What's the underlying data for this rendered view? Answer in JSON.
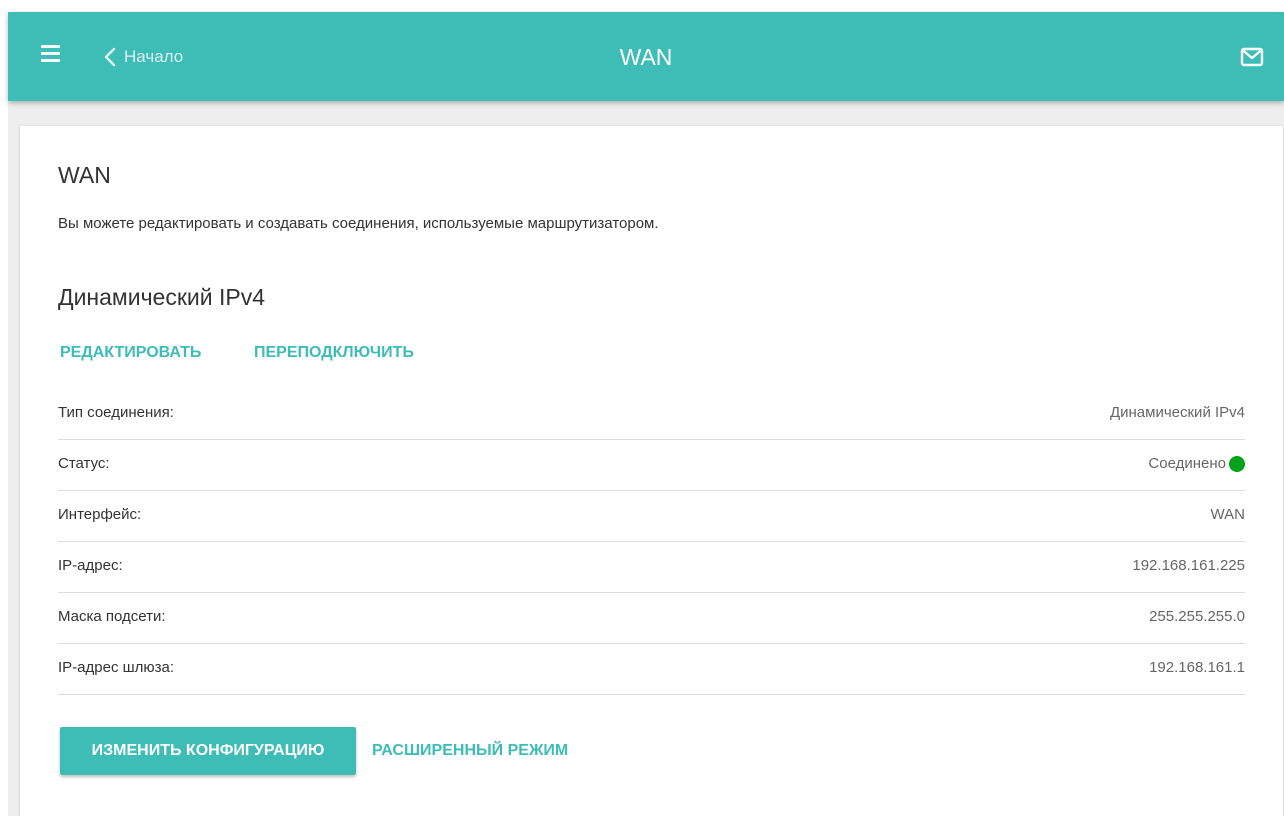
{
  "header": {
    "back_label": "Начало",
    "title": "WAN",
    "menu_icon": "hamburger-menu-icon",
    "back_icon": "chevron-left-icon",
    "mail_icon": "envelope-icon"
  },
  "card": {
    "title": "WAN",
    "description": "Вы можете редактировать и создавать соединения, используемые маршрутизатором."
  },
  "connection": {
    "name": "Динамический IPv4",
    "edit_label": "РЕДАКТИРОВАТЬ",
    "reconnect_label": "ПЕРЕПОДКЛЮЧИТЬ",
    "rows": [
      {
        "label": "Тип соединения:",
        "value": "Динамический IPv4"
      },
      {
        "label": "Статус:",
        "value": "Соединено",
        "status_color": "#00a31a"
      },
      {
        "label": "Интерфейс:",
        "value": "WAN"
      },
      {
        "label": "IP-адрес:",
        "value": "192.168.161.225"
      },
      {
        "label": "Маска подсети:",
        "value": "255.255.255.0"
      },
      {
        "label": "IP-адрес шлюза:",
        "value": "192.168.161.1"
      }
    ]
  },
  "actions": {
    "change_config_label": "ИЗМЕНИТЬ КОНФИГУРАЦИЮ",
    "advanced_mode_label": "РАСШИРЕННЫЙ РЕЖИМ"
  },
  "colors": {
    "accent": "#3dbdb6",
    "status_connected": "#00a31a"
  }
}
